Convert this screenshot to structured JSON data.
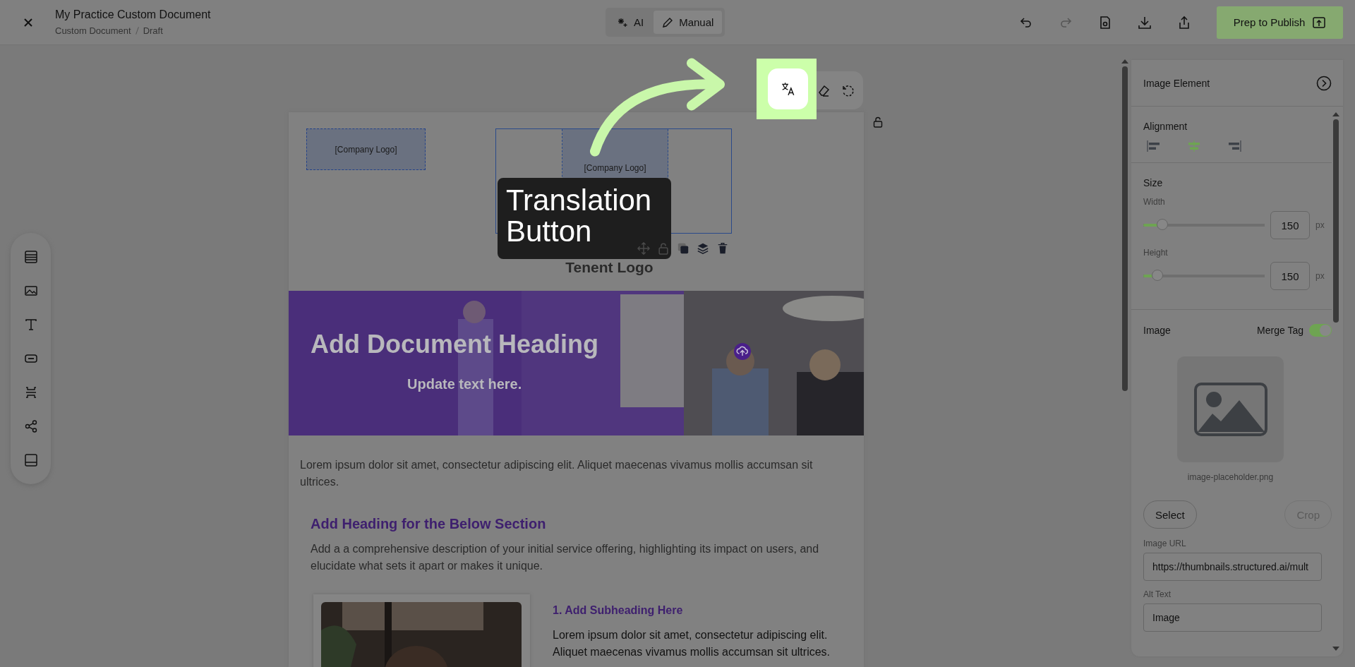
{
  "header": {
    "title": "My Practice Custom Document",
    "breadcrumb": [
      "Custom Document",
      "Draft"
    ],
    "modes": [
      {
        "label": "AI",
        "kind": "ai",
        "selected": false
      },
      {
        "label": "Manual",
        "kind": "manual",
        "selected": true
      }
    ],
    "publish_button": "Prep to Publish"
  },
  "tooltip": {
    "text": "Translation Button"
  },
  "canvas": {
    "logo_placeholders": [
      "[Company Logo]",
      "[Company Logo]"
    ],
    "tenant_logo": "Tenent Logo",
    "banner": {
      "heading": "Add Document Heading",
      "subheading": "Update text here."
    },
    "intro": "Lorem ipsum dolor sit amet, consectetur adipiscing elit. Aliquet maecenas vivamus mollis accumsan sit ultrices.",
    "section": {
      "heading": "Add Heading for the Below Section",
      "description": "Add a a comprehensive description of your initial service offering, highlighting its impact on users, and elucidate what sets it apart or makes it unique.",
      "item": {
        "subheading": "1. Add Subheading Here",
        "text": "Lorem ipsum dolor sit amet, consectetur adipiscing elit. Aliquet maecenas vivamus mollis accumsan sit ultrices."
      }
    }
  },
  "properties": {
    "title": "Image Element",
    "alignment": {
      "label": "Alignment",
      "options": [
        {
          "kind": "left",
          "selected": false
        },
        {
          "kind": "center",
          "selected": true
        },
        {
          "kind": "right",
          "selected": false
        }
      ]
    },
    "size": {
      "label": "Size",
      "fields": [
        {
          "label": "Width",
          "level": 0.16,
          "value": "150",
          "unit": "px"
        },
        {
          "label": "Height",
          "level": 0.12,
          "value": "150",
          "unit": "px"
        }
      ]
    },
    "image": {
      "label": "Image",
      "merge_tag": {
        "label": "Merge Tag",
        "on": true
      },
      "filename": "image-placeholder.png",
      "select_button": "Select",
      "crop_button": {
        "label": "Crop",
        "disabled": true
      }
    },
    "image_url": {
      "label": "Image URL",
      "value": "https://thumbnails.structured.ai/mult"
    },
    "alt_text": {
      "label": "Alt Text",
      "value": "Image"
    }
  }
}
